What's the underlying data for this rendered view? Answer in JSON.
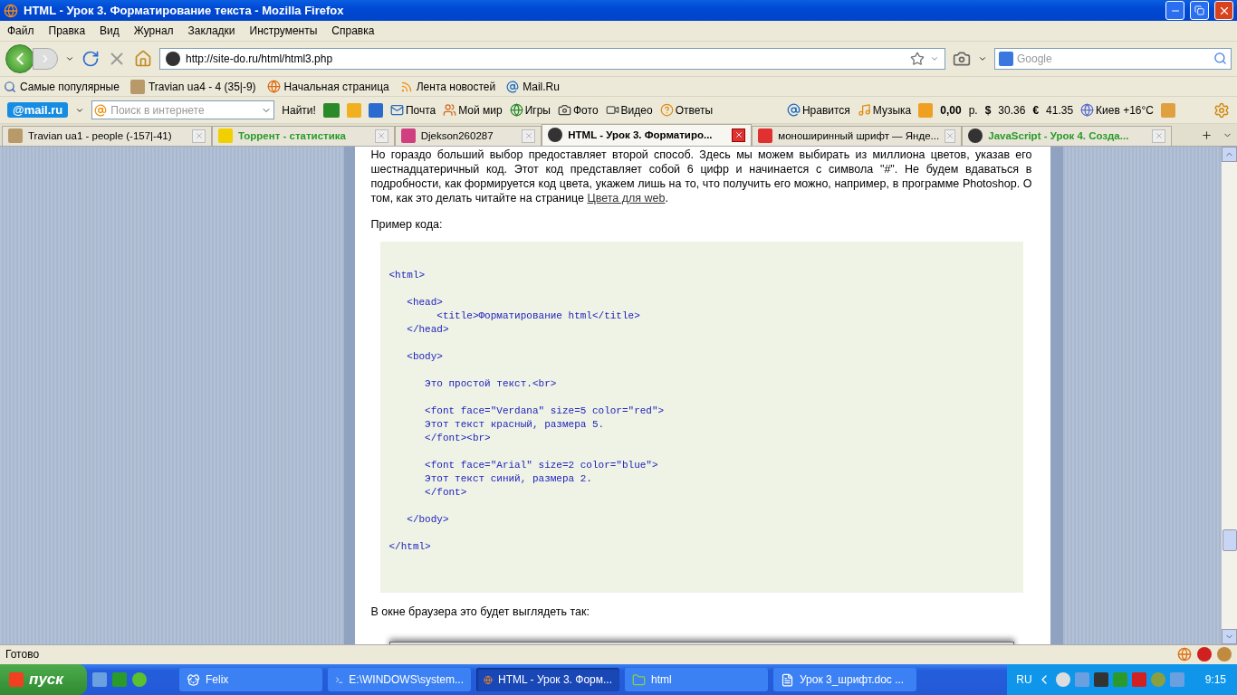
{
  "window": {
    "title": "HTML - Урок 3. Форматирование текста - Mozilla Firefox"
  },
  "menu": [
    "Файл",
    "Правка",
    "Вид",
    "Журнал",
    "Закладки",
    "Инструменты",
    "Справка"
  ],
  "navigation": {
    "url": "http://site-do.ru/html/html3.php",
    "search_placeholder": "Google"
  },
  "bookmarks": [
    "Самые популярные",
    "Travian ua4 - 4 (35|-9)",
    "Начальная страница",
    "Лента новостей",
    "Mail.Ru"
  ],
  "mailru_toolbar": {
    "logo": "@mail.ru",
    "search_placeholder": "Поиск в интернете",
    "find_button": "Найти!",
    "links": [
      "Почта",
      "Мой мир",
      "Игры",
      "Фото",
      "Видео",
      "Ответы"
    ],
    "likes": "Нравится",
    "music": "Музыка",
    "balance": "0,00",
    "balance_unit": "р.",
    "usd_sign": "$",
    "usd": "30.36",
    "eur_sign": "€",
    "eur": "41.35",
    "weather": "Киев +16°C"
  },
  "tabs": [
    {
      "label": "Travian ua1 - people (-157|-41)",
      "selected": false,
      "highlighted": false
    },
    {
      "label": "Торрент - статистика",
      "selected": false,
      "highlighted": true
    },
    {
      "label": "Djekson260287",
      "selected": false,
      "highlighted": false
    },
    {
      "label": "HTML - Урок 3. Форматиро...",
      "selected": true,
      "highlighted": false
    },
    {
      "label": "моноширинный шрифт — Янде...",
      "selected": false,
      "highlighted": false
    },
    {
      "label": "JavaScript - Урок 4. Созда...",
      "selected": false,
      "highlighted": true
    }
  ],
  "page": {
    "paragraph": "Но гораздо больший выбор предоставляет второй способ. Здесь мы можем выбирать из миллиона цветов, указав его шестнадцатеричный код. Этот код представляет собой 6 цифр и начинается с символа \"#\". Не будем вдаваться в подробности, как формируется код цвета, укажем лишь на то, что получить его можно, например, в программе Photoshop. О том, как это делать читайте на странице",
    "link": "Цвета для web",
    "after_link": ".",
    "code_caption": "Пример кода:",
    "code": "<html>\n\n   <head>\n        <title>Форматирование html</title>\n   </head>\n\n   <body>\n\n      Это простой текст.<br>\n\n      <font face=\"Verdana\" size=5 color=\"red\">\n      Этот текст красный, размера 5.\n      </font><br>\n\n      <font face=\"Arial\" size=2 color=\"blue\">\n      Этот текст синий, размера 2.\n      </font>\n\n   </body>\n\n</html>",
    "result_caption": "В окне браузера это будет выглядеть так:"
  },
  "status_bar": "Готово",
  "taskbar": {
    "start": "пуск",
    "items": [
      {
        "label": "Felix",
        "selected": false
      },
      {
        "label": "E:\\WINDOWS\\system...",
        "selected": false
      },
      {
        "label": "HTML - Урок 3. Форм...",
        "selected": true
      },
      {
        "label": "html",
        "selected": false
      },
      {
        "label": "Урок 3_шрифт.doc ...",
        "selected": false
      }
    ],
    "language": "RU",
    "clock": "9:15"
  }
}
